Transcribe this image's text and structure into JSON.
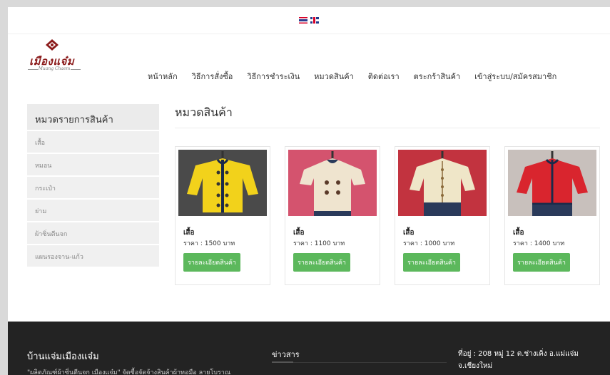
{
  "languages": [
    {
      "name": "thai-flag-icon"
    },
    {
      "name": "uk-flag-icon"
    }
  ],
  "logo": {
    "text": "เมืองแจ๋ม",
    "tagline": "Muang Chaem",
    "brand_color": "#8b1a1a"
  },
  "nav": {
    "items": [
      "หน้าหลัก",
      "วิธีการสั่งซื้อ",
      "วิธีการชำระเงิน",
      "หมวดสินค้า",
      "ติดต่อเรา",
      "ตระกร้าสินค้า",
      "เข้าสู่ระบบ/สมัครสมาชิก"
    ]
  },
  "sidebar": {
    "title": "หมวดรายการสินค้า",
    "items": [
      "เสื้อ",
      "หมอน",
      "กระเป๋า",
      "ย่าม",
      "ผ้าซิ่นตีนจก",
      "แผนรองจาน-แก้ว"
    ]
  },
  "main": {
    "title": "หมวดสินค้า"
  },
  "products": [
    {
      "name": "เสื้อ",
      "price": "ราคา : 1500 บาท",
      "button": "รายละเอียดสินค้า",
      "bg": "#4a4a4a",
      "color": "#f2d21b"
    },
    {
      "name": "เสื้อ",
      "price": "ราคา : 1100 บาท",
      "button": "รายละเอียดสินค้า",
      "bg": "#d4536e",
      "color": "#efe4cf"
    },
    {
      "name": "เสื้อ",
      "price": "ราคา : 1000 บาท",
      "button": "รายละเอียดสินค้า",
      "bg": "#c2333f",
      "color": "#efe6c8"
    },
    {
      "name": "เสื้อ",
      "price": "ราคา : 1400 บาท",
      "button": "รายละเอียดสินค้า",
      "bg": "#c8c0bc",
      "color": "#d9252e"
    }
  ],
  "footer": {
    "title": "บ้านแจ่มเมืองแจ๋ม",
    "text": "\"ผลิตภัณฑ์ผ้าซิ่นตีนจก เมืองแจ๋ม\" จัดซื้อจัดจ้างสินค้าผ้าทอมือ ลายโบราณ",
    "news_title": "ข่าวสาร",
    "address_line1": "ที่อยู่ : 208 หมู่ 12 ต.ช่างเคิ่ง อ.แม่แจ่ม",
    "address_line2": "จ.เชียงใหม่"
  },
  "colors": {
    "accent_button": "#5cb85c",
    "footer_bg": "#232323"
  }
}
